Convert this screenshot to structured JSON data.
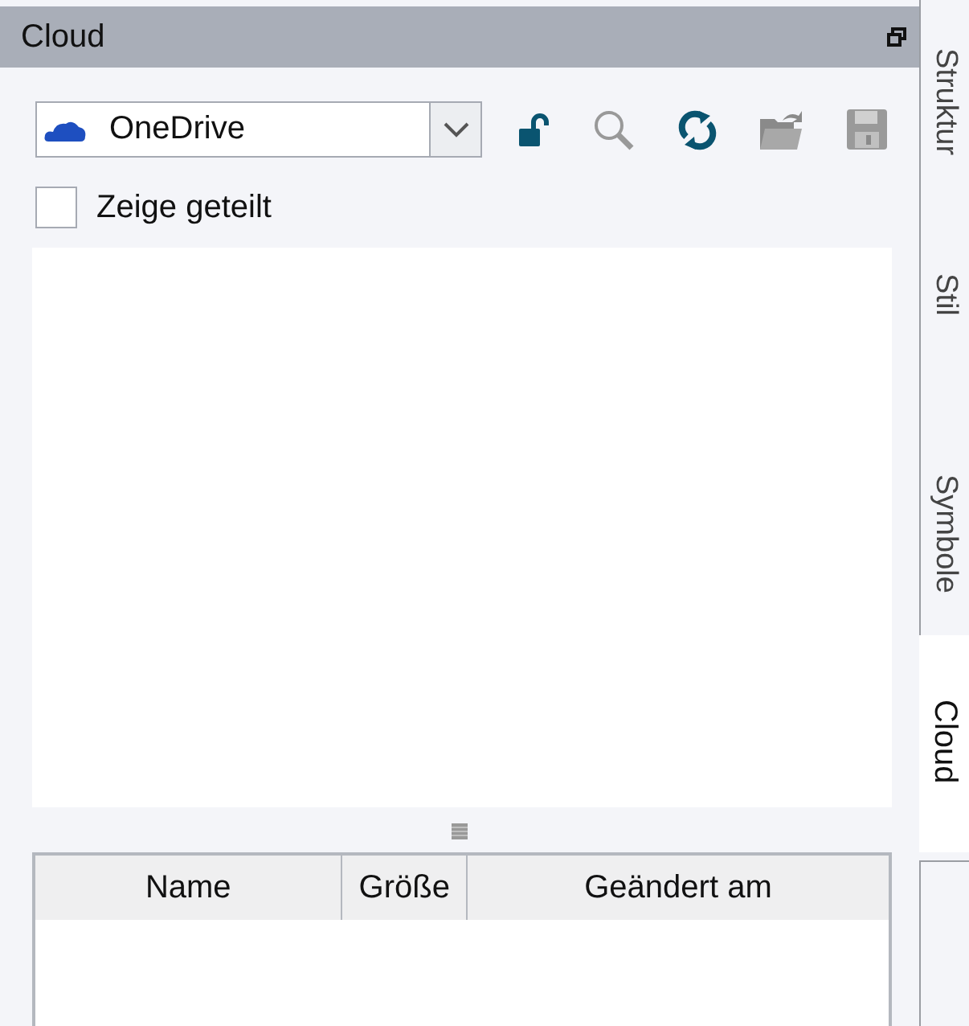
{
  "panel": {
    "title": "Cloud"
  },
  "account": {
    "value": "OneDrive"
  },
  "show_shared": {
    "label": "Zeige geteilt",
    "checked": false
  },
  "table": {
    "columns": [
      "Name",
      "Größe",
      "Geändert am"
    ]
  },
  "side_tabs": [
    {
      "label": "Struktur",
      "selected": false
    },
    {
      "label": "Stil",
      "selected": false
    },
    {
      "label": "Symbole",
      "selected": false
    },
    {
      "label": "Cloud",
      "selected": true
    }
  ]
}
